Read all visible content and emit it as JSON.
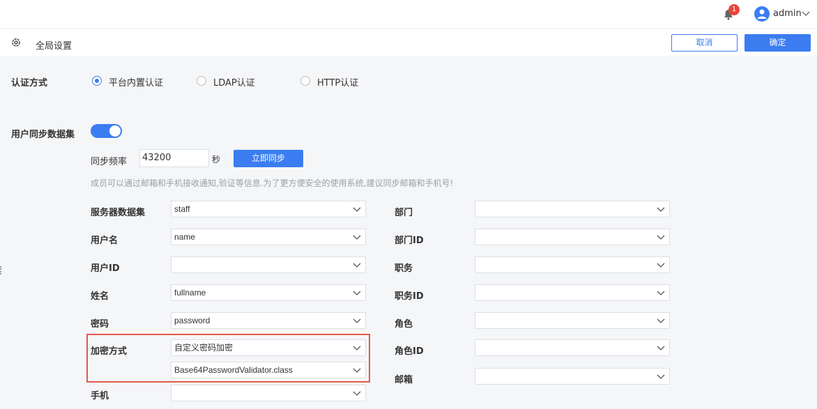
{
  "topbar": {
    "notification_count": "1",
    "user": "admin"
  },
  "header": {
    "title": "全局设置",
    "cancel_label": "取消",
    "ok_label": "确定"
  },
  "auth": {
    "label": "认证方式",
    "options": [
      "平台内置认证",
      "LDAP认证",
      "HTTP认证"
    ],
    "selected": "平台内置认证"
  },
  "sync": {
    "label": "用户同步数据集",
    "enabled": true,
    "freq_label": "同步频率",
    "freq_value": "43200",
    "freq_unit": "秒",
    "sync_now_label": "立即同步",
    "hint": "成员可以通过邮箱和手机接收通知,验证等信息.为了更方便安全的使用系统,建议同步邮箱和手机号!"
  },
  "left_fields": [
    {
      "label": "服务器数据集",
      "value": "staff"
    },
    {
      "label": "用户名",
      "value": "name"
    },
    {
      "label": "用户ID",
      "value": ""
    },
    {
      "label": "姓名",
      "value": "fullname"
    },
    {
      "label": "密码",
      "value": "password"
    },
    {
      "label": "加密方式",
      "value": "自定义密码加密",
      "value2": "Base64PasswordValidator.class"
    },
    {
      "label": "手机",
      "value": ""
    }
  ],
  "right_fields": [
    {
      "label": "部门",
      "value": ""
    },
    {
      "label": "部门ID",
      "value": ""
    },
    {
      "label": "职务",
      "value": ""
    },
    {
      "label": "职务ID",
      "value": ""
    },
    {
      "label": "角色",
      "value": ""
    },
    {
      "label": "角色ID",
      "value": ""
    },
    {
      "label": "邮箱",
      "value": ""
    }
  ],
  "colors": {
    "accent": "#3b7df0",
    "highlight": "#e15a4b",
    "badge": "#e8453c"
  }
}
